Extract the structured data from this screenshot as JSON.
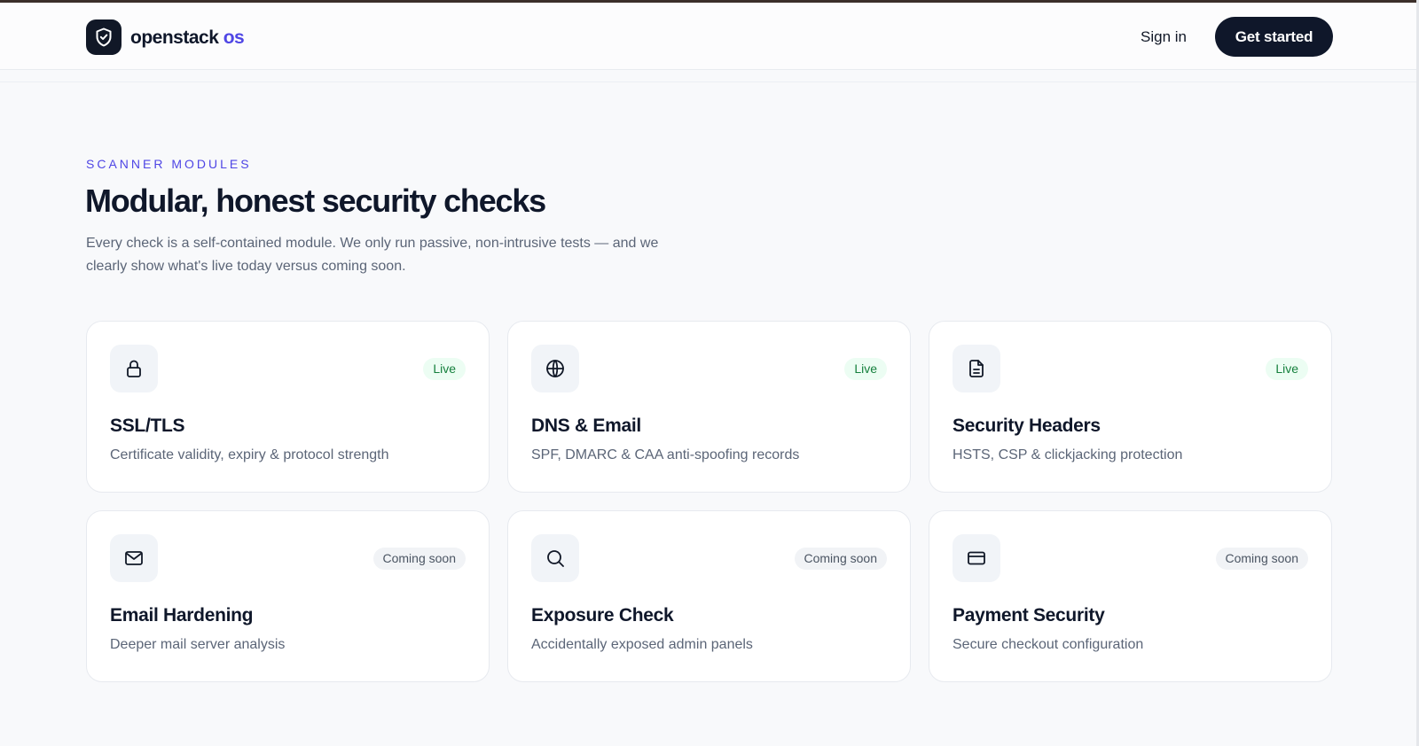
{
  "header": {
    "brand_main": "openstack",
    "brand_accent": "os",
    "sign_in": "Sign in",
    "cta": "Get started"
  },
  "hero": {
    "eyebrow": "SCANNER MODULES",
    "title": "Modular, honest security checks",
    "lede_line1": "Every check is a self-contained module. We only run passive, non-intrusive tests — and we",
    "lede_line2": "clearly show what's live today versus coming soon."
  },
  "modules": [
    {
      "title": "SSL/TLS",
      "desc": "Certificate validity, expiry & protocol strength",
      "status": "Live",
      "icon": "lock-icon"
    },
    {
      "title": "DNS & Email",
      "desc": "SPF, DMARC & CAA anti-spoofing records",
      "status": "Live",
      "icon": "globe-icon"
    },
    {
      "title": "Security Headers",
      "desc": "HSTS, CSP & clickjacking protection",
      "status": "Live",
      "icon": "document-icon"
    },
    {
      "title": "Email Hardening",
      "desc": "Deeper mail server analysis",
      "status": "Coming soon",
      "icon": "mail-icon"
    },
    {
      "title": "Exposure Check",
      "desc": "Accidentally exposed admin panels",
      "status": "Coming soon",
      "icon": "search-icon"
    },
    {
      "title": "Payment Security",
      "desc": "Secure checkout configuration",
      "status": "Coming soon",
      "icon": "credit-card-icon"
    }
  ],
  "colors": {
    "accent": "#4f46e5",
    "dark": "#0f172a",
    "live_bg": "#ecfdf3",
    "live_text": "#15803d",
    "soon_bg": "#f1f3f6"
  }
}
